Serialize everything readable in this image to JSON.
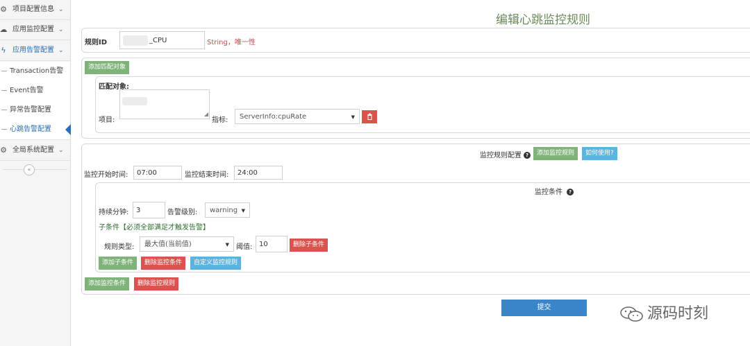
{
  "sidebar": {
    "items": [
      {
        "label": "项目配置信息",
        "icon": "gears-icon"
      },
      {
        "label": "应用监控配置",
        "icon": "cloud-icon"
      },
      {
        "label": "应用告警配置",
        "icon": "bolt-icon"
      }
    ],
    "sub_items": [
      {
        "label": "Transaction告警"
      },
      {
        "label": "Event告警"
      },
      {
        "label": "异常告警配置"
      },
      {
        "label": "心跳告警配置"
      }
    ],
    "global_item": {
      "label": "全局系统配置",
      "icon": "gear-icon"
    },
    "collapse_icon": "«"
  },
  "page": {
    "title": "编辑心跳监控规则"
  },
  "rule": {
    "id_label": "规则ID",
    "id_value": "_CPU",
    "id_hint": "String，唯一性"
  },
  "match": {
    "add_button": "添加匹配对象",
    "section_label": "匹配对象:",
    "project_label": "项目:",
    "metric_label": "指标:",
    "metric_value": "ServerInfo:cpuRate",
    "delete_icon": "trash-icon"
  },
  "monitor": {
    "config_label": "监控规则配置",
    "add_rule_button": "添加监控规则",
    "how_to_button": "如何使用?",
    "start_label": "监控开始时间:",
    "start_value": "07:00",
    "end_label": "监控结束时间:",
    "end_value": "24:00",
    "condition_label": "监控条件",
    "duration_label": "持续分钟:",
    "duration_value": "3",
    "level_label": "告警级别:",
    "level_value": "warning",
    "sub_condition_label": "子条件【必须全部满足才触发告警】",
    "rule_type_label": "规则类型:",
    "rule_type_value": "最大值(当前值)",
    "threshold_label": "阈值:",
    "threshold_value": "10",
    "delete_sub_button": "删除子条件",
    "add_sub_button": "添加子条件",
    "delete_condition_button": "删除监控条件",
    "custom_rule_button": "自定义监控规则",
    "add_condition_button": "添加监控条件",
    "delete_rule_button": "删除监控规则"
  },
  "submit_label": "提交",
  "watermark": "源码时刻",
  "colors": {
    "green": "#7fb37a",
    "red": "#d9534f",
    "blue": "#5bb3e0",
    "primary": "#3a86c8",
    "title": "#6a8a5a"
  }
}
